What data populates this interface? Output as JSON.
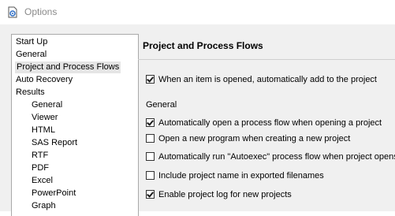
{
  "window": {
    "title": "Options",
    "icon": "options-app-icon"
  },
  "nav": {
    "items": [
      {
        "label": "Start Up",
        "level": 0,
        "selected": false
      },
      {
        "label": "General",
        "level": 0,
        "selected": false
      },
      {
        "label": "Project and Process Flows",
        "level": 0,
        "selected": true
      },
      {
        "label": "Auto Recovery",
        "level": 0,
        "selected": false
      },
      {
        "label": "Results",
        "level": 0,
        "selected": false
      },
      {
        "label": "General",
        "level": 1,
        "selected": false
      },
      {
        "label": "Viewer",
        "level": 1,
        "selected": false
      },
      {
        "label": "HTML",
        "level": 1,
        "selected": false
      },
      {
        "label": "SAS Report",
        "level": 1,
        "selected": false
      },
      {
        "label": "RTF",
        "level": 1,
        "selected": false
      },
      {
        "label": "PDF",
        "level": 1,
        "selected": false
      },
      {
        "label": "Excel",
        "level": 1,
        "selected": false
      },
      {
        "label": "PowerPoint",
        "level": 1,
        "selected": false
      },
      {
        "label": "Graph",
        "level": 1,
        "selected": false
      }
    ]
  },
  "panel": {
    "title": "Project and Process Flows",
    "auto_add": {
      "label": "When an item is opened, automatically add to the project",
      "checked": true
    },
    "general_label": "General",
    "options": [
      {
        "label": "Automatically open a process flow when opening a project",
        "checked": true
      },
      {
        "label": "Open a new program when creating a new project",
        "checked": false
      },
      {
        "label": "Automatically run \"Autoexec\" process flow when project opens",
        "checked": false
      },
      {
        "label": "Include project name in exported filenames",
        "checked": false
      },
      {
        "label": "Enable project log for new projects",
        "checked": true
      }
    ]
  }
}
